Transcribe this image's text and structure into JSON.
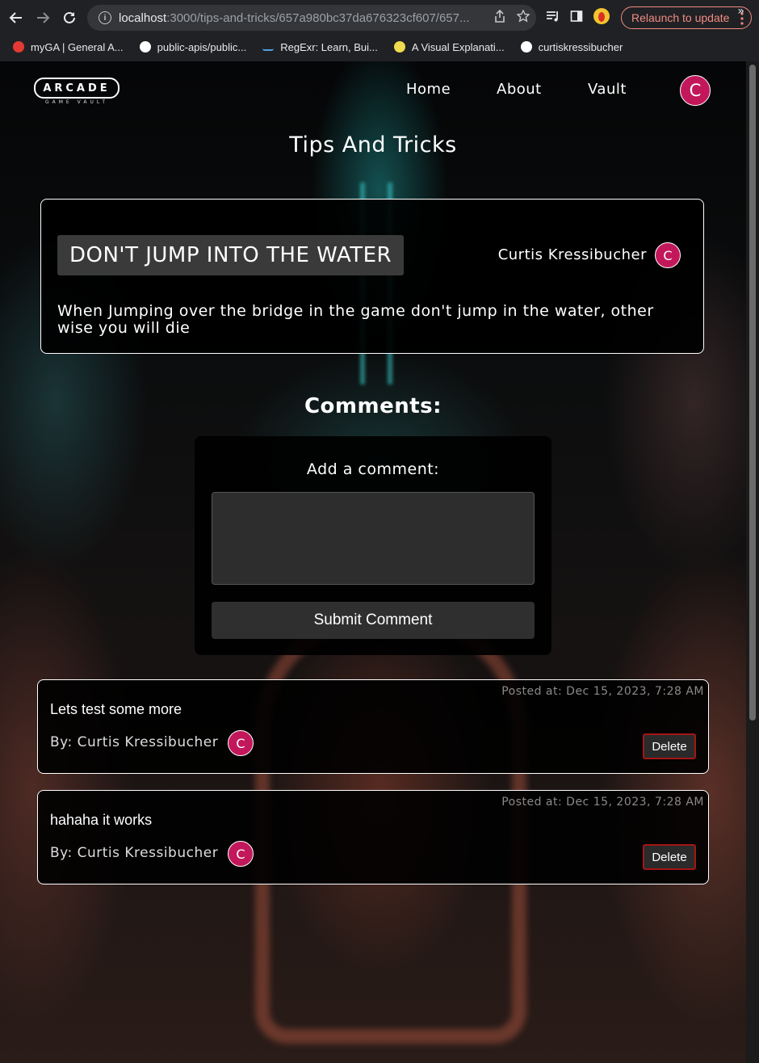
{
  "browser": {
    "url_host": "localhost",
    "url_path": ":3000/tips-and-tricks/657a980bc37da676323cf607/657...",
    "relaunch_label": "Relaunch to update",
    "bookmarks": [
      {
        "label": "myGA | General A...",
        "icon": "ga-icon",
        "color": "#e53935"
      },
      {
        "label": "public-apis/public...",
        "icon": "github-icon",
        "color": "#ffffff"
      },
      {
        "label": "RegExr: Learn, Bui...",
        "icon": "regexr-icon",
        "color": "#4fa3e0"
      },
      {
        "label": "A Visual Explanati...",
        "icon": "js-icon",
        "color": "#f0db4f"
      },
      {
        "label": "curtiskressibucher",
        "icon": "github-icon",
        "color": "#ffffff"
      }
    ],
    "bookmarks_more": "»"
  },
  "nav": {
    "logo_text": "ARCADE",
    "logo_sub": "GAME VAULT",
    "links": [
      "Home",
      "About",
      "Vault"
    ],
    "avatar_initial": "C",
    "avatar_color": "#c2185b"
  },
  "page": {
    "title": "Tips And Tricks"
  },
  "tip": {
    "title": "DON'T JUMP INTO THE WATER",
    "author": "Curtis Kressibucher",
    "author_initial": "C",
    "body": "When Jumping over the bridge in the game don't jump in the water, other wise you will die"
  },
  "comments_section": {
    "title": "Comments:",
    "form_label": "Add a comment:",
    "textarea_value": "",
    "submit_label": "Submit Comment"
  },
  "comments": [
    {
      "posted": "Posted at: Dec 15, 2023, 7:28 AM",
      "text": "Lets test some more",
      "by": "By: Curtis Kressibucher",
      "initial": "C",
      "delete_label": "Delete"
    },
    {
      "posted": "Posted at: Dec 15, 2023, 7:28 AM",
      "text": "hahaha it works",
      "by": "By: Curtis Kressibucher",
      "initial": "C",
      "delete_label": "Delete"
    }
  ]
}
